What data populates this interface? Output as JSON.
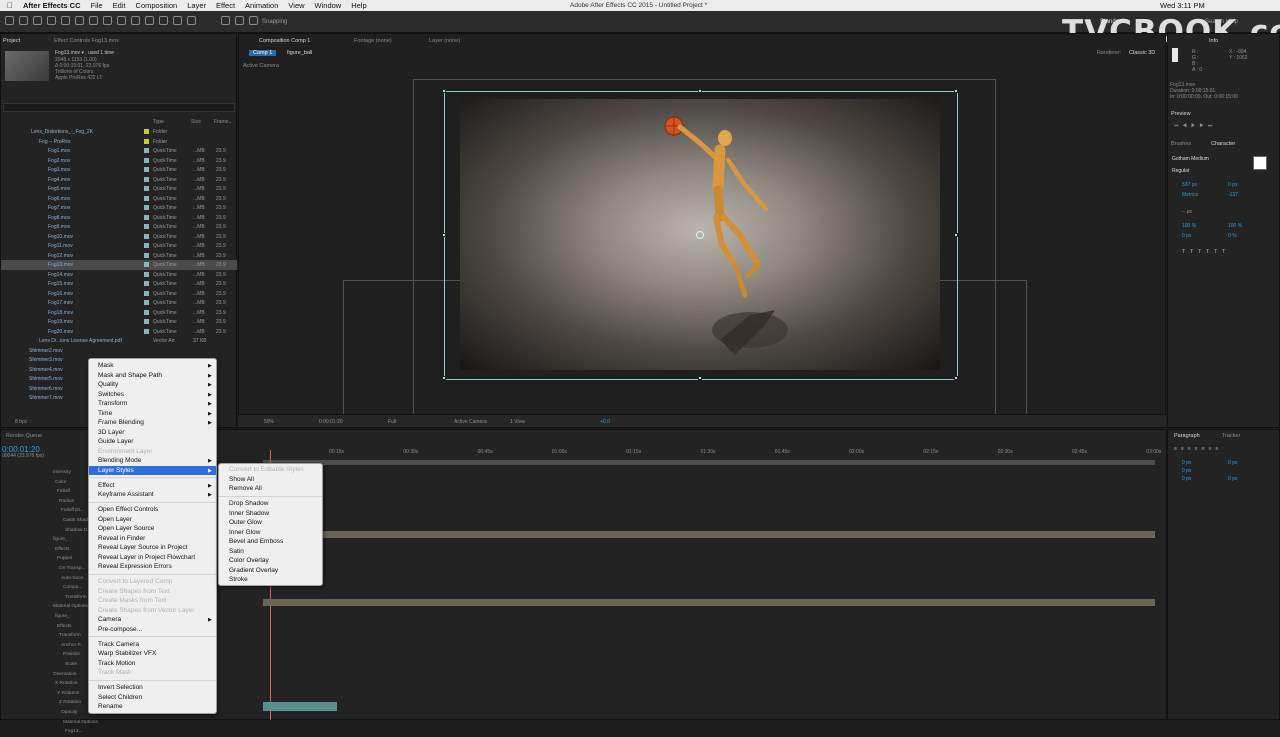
{
  "menubar": {
    "app": "After Effects CC",
    "items": [
      "File",
      "Edit",
      "Composition",
      "Layer",
      "Effect",
      "Animation",
      "View",
      "Window",
      "Help"
    ],
    "window_title": "Adobe After Effects CC 2015 - Untitled Project *",
    "clock": "Wed 3:11 PM"
  },
  "watermark": "TVCBOOK.com",
  "toolbar": {
    "snapping": "Snapping",
    "workspace": "Standard",
    "search_help": "Search Help"
  },
  "project": {
    "tab_project": "Project",
    "tab_effect_controls": "Effect Controls Fog13.mov",
    "footage_name": "Fog13.mov ▾ , used 1 time",
    "footage_info": [
      "2048 x 1153 (1.00)",
      "Δ 0:00:15:01, 23.976 fps",
      "Trillions of Colors",
      "Apple ProRes 422 LT"
    ],
    "col_type": "Type",
    "col_size": "Size",
    "col_frame": "Frame...",
    "folders": [
      {
        "name": "Lens_Distortions_-_Fog_2K",
        "type": "Folder"
      },
      {
        "name": "Fog -- ProRes",
        "type": "Folder"
      }
    ],
    "files": [
      {
        "name": "Fog1.mov",
        "type": "QuickTime",
        "size": "...MB",
        "fps": "23.9"
      },
      {
        "name": "Fog2.mov",
        "type": "QuickTime",
        "size": "...MB",
        "fps": "23.9"
      },
      {
        "name": "Fog3.mov",
        "type": "QuickTime",
        "size": "...MB",
        "fps": "23.9"
      },
      {
        "name": "Fog4.mov",
        "type": "QuickTime",
        "size": "...MB",
        "fps": "23.9"
      },
      {
        "name": "Fog5.mov",
        "type": "QuickTime",
        "size": "...MB",
        "fps": "23.9"
      },
      {
        "name": "Fog6.mov",
        "type": "QuickTime",
        "size": "...MB",
        "fps": "23.9"
      },
      {
        "name": "Fog7.mov",
        "type": "QuickTime",
        "size": "...MB",
        "fps": "23.9"
      },
      {
        "name": "Fog8.mov",
        "type": "QuickTime",
        "size": "...MB",
        "fps": "23.9"
      },
      {
        "name": "Fog9.mov",
        "type": "QuickTime",
        "size": "...MB",
        "fps": "23.9"
      },
      {
        "name": "Fog10.mov",
        "type": "QuickTime",
        "size": "...MB",
        "fps": "23.9"
      },
      {
        "name": "Fog11.mov",
        "type": "QuickTime",
        "size": "...MB",
        "fps": "23.9"
      },
      {
        "name": "Fog12.mov",
        "type": "QuickTime",
        "size": "...MB",
        "fps": "23.9"
      },
      {
        "name": "Fog13.mov",
        "type": "QuickTime",
        "size": "...MB",
        "fps": "23.9"
      },
      {
        "name": "Fog14.mov",
        "type": "QuickTime",
        "size": "...MB",
        "fps": "23.9"
      },
      {
        "name": "Fog15.mov",
        "type": "QuickTime",
        "size": "...MB",
        "fps": "23.9"
      },
      {
        "name": "Fog16.mov",
        "type": "QuickTime",
        "size": "...MB",
        "fps": "23.9"
      },
      {
        "name": "Fog17.mov",
        "type": "QuickTime",
        "size": "...MB",
        "fps": "23.9"
      },
      {
        "name": "Fog18.mov",
        "type": "QuickTime",
        "size": "...MB",
        "fps": "23.9"
      },
      {
        "name": "Fog19.mov",
        "type": "QuickTime",
        "size": "...MB",
        "fps": "23.9"
      },
      {
        "name": "Fog20.mov",
        "type": "QuickTime",
        "size": "...MB",
        "fps": "23.9"
      }
    ],
    "pdf": {
      "name": "Lens Di...ions License Agreement.pdf",
      "type": "Vector Art",
      "size": "37 KB"
    },
    "shimmers": [
      "Shimmer2.mov",
      "Shimmer3.mov",
      "Shimmer4.mov",
      "Shimmer5.mov",
      "Shimmer6.mov",
      "Shimmer7.mov"
    ],
    "bpc": "8 bpc"
  },
  "composition": {
    "tab": "Composition Comp 1",
    "tab_footage": "Footage (none)",
    "tab_layer": "Layer (none)",
    "breadcrumb_comp": "Comp 1",
    "breadcrumb_layer": "figure_ball",
    "renderer_label": "Renderer:",
    "renderer_value": "Classic 3D",
    "active_camera": "Active Camera",
    "footer": {
      "zoom": "50%",
      "timecode": "0:00:01:20",
      "resolution": "Full",
      "view": "Active Camera",
      "views": "1 View",
      "exposure": "+0.0"
    }
  },
  "timeline": {
    "render_queue": "Render Queue",
    "timecode": "0:00:01:20",
    "timecode_sub": "00044 (23.976 fps)",
    "ruler": [
      "00:15s",
      "00:30s",
      "00:45s",
      "01:00s",
      "01:15s",
      "01:30s",
      "01:45s",
      "02:00s",
      "02:15s",
      "02:30s",
      "02:45s",
      "03:00s"
    ],
    "layer_rows": [
      "Intensity",
      "Color",
      "Falloff",
      "Radius",
      "Falloff Di...",
      "Casts Shadows",
      "Shadow D...",
      "figure_",
      "Effects",
      "Puppet",
      "On Transp...",
      "Auto-trace...",
      "Compo...",
      "Transform",
      "Material Options",
      "figure_",
      "Effects",
      "Transform",
      "Anchor P...",
      "Position",
      "Scale",
      "Orientation",
      "X Rotation",
      "Y Rotation",
      "Z Rotation",
      "Opacity",
      "Material Options",
      "Fog13..."
    ]
  },
  "info": {
    "tab": "Info",
    "r": "R :",
    "g": "G :",
    "b": "B :",
    "a": "A : 0",
    "x": "X : -884",
    "y": "Y : 1062",
    "clip": "Fog13.mov",
    "dur": "Duration: 0:00:15:01",
    "inout": "In: 0:00:00:00, Out: 0:00:15:00"
  },
  "preview": {
    "tab": "Preview"
  },
  "character": {
    "tab_brushes": "Brushes",
    "tab_character": "Character",
    "font": "Gotham Medium",
    "style": "Regular",
    "size": "537 px",
    "leading": "0 px",
    "kerning": "Metrics",
    "tracking": "-137",
    "unit": "-- px",
    "vscale": "100 %",
    "hscale": "100 %",
    "baseline": "0 px",
    "tsume": "0 %"
  },
  "paragraph": {
    "tab": "Paragraph",
    "tab_tracker": "Tracker",
    "indent": [
      "0 px",
      "0 px",
      "0 px",
      "0 px",
      "0 px"
    ]
  },
  "context_menu": {
    "items": [
      {
        "label": "Mask",
        "sub": true
      },
      {
        "label": "Mask and Shape Path",
        "sub": true
      },
      {
        "label": "Quality",
        "sub": true
      },
      {
        "label": "Switches",
        "sub": true
      },
      {
        "label": "Transform",
        "sub": true
      },
      {
        "label": "Time",
        "sub": true
      },
      {
        "label": "Frame Blending",
        "sub": true
      },
      {
        "label": "3D Layer"
      },
      {
        "label": "Guide Layer"
      },
      {
        "label": "Environment Layer",
        "disabled": true
      },
      {
        "label": "Blending Mode",
        "sub": true
      },
      {
        "label": "Layer Styles",
        "sub": true,
        "highlight": true
      },
      {
        "sep": true
      },
      {
        "label": "Effect",
        "sub": true
      },
      {
        "label": "Keyframe Assistant",
        "sub": true
      },
      {
        "sep": true
      },
      {
        "label": "Open Effect Controls"
      },
      {
        "label": "Open Layer"
      },
      {
        "label": "Open Layer Source"
      },
      {
        "label": "Reveal in Finder"
      },
      {
        "label": "Reveal Layer Source in Project"
      },
      {
        "label": "Reveal Layer in Project Flowchart"
      },
      {
        "label": "Reveal Expression Errors"
      },
      {
        "sep": true
      },
      {
        "label": "Convert to Layered Comp",
        "disabled": true
      },
      {
        "label": "Create Shapes from Text",
        "disabled": true
      },
      {
        "label": "Create Masks from Text",
        "disabled": true
      },
      {
        "label": "Create Shapes from Vector Layer",
        "disabled": true
      },
      {
        "label": "Camera",
        "sub": true
      },
      {
        "label": "Pre-compose..."
      },
      {
        "sep": true
      },
      {
        "label": "Track Camera"
      },
      {
        "label": "Warp Stabilizer VFX"
      },
      {
        "label": "Track Motion"
      },
      {
        "label": "Track Mask",
        "disabled": true
      },
      {
        "sep": true
      },
      {
        "label": "Invert Selection"
      },
      {
        "label": "Select Children"
      },
      {
        "label": "Rename"
      }
    ]
  },
  "submenu": {
    "items": [
      {
        "label": "Convert to Editable Styles",
        "disabled": true
      },
      {
        "label": "Show All"
      },
      {
        "label": "Remove All"
      },
      {
        "sep": true
      },
      {
        "label": "Drop Shadow"
      },
      {
        "label": "Inner Shadow"
      },
      {
        "label": "Outer Glow"
      },
      {
        "label": "Inner Glow"
      },
      {
        "label": "Bevel and Emboss"
      },
      {
        "label": "Satin"
      },
      {
        "label": "Color Overlay"
      },
      {
        "label": "Gradient Overlay"
      },
      {
        "label": "Stroke"
      }
    ]
  }
}
